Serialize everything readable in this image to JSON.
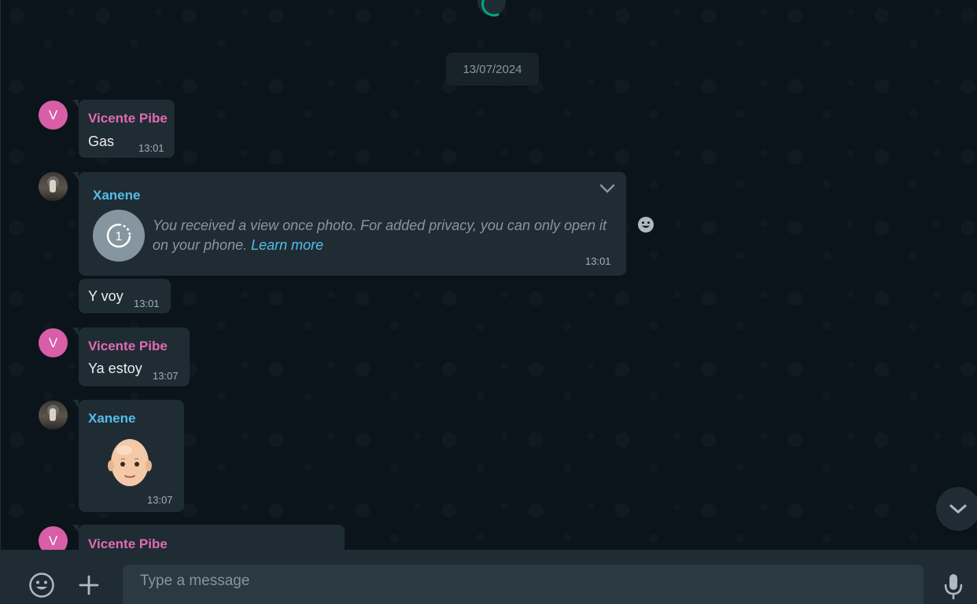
{
  "date_divider": "13/07/2024",
  "messages": [
    {
      "avatar_letter": "V",
      "sender": "Vicente Pibe",
      "text": "Gas",
      "time": "13:01"
    },
    {
      "sender": "Xanene",
      "view_once_text": "You received a view once photo. For added privacy, you can only open it on your phone.",
      "learn_more": "Learn more",
      "time": "13:01"
    },
    {
      "text": "Y voy",
      "time": "13:01"
    },
    {
      "avatar_letter": "V",
      "sender": "Vicente Pibe",
      "text": "Ya estoy",
      "time": "13:07"
    },
    {
      "sender": "Xanene",
      "time": "13:07",
      "sticker_icon": "bald-person-emoji"
    },
    {
      "avatar_letter": "V",
      "sender": "Vicente Pibe"
    }
  ],
  "composer": {
    "placeholder": "Type a message",
    "emoji_icon": "smiley-icon",
    "attach_icon": "plus-icon",
    "mic_icon": "microphone-icon"
  },
  "colors": {
    "background": "#0b141a",
    "bubble": "#202c33",
    "accent_green": "#00a884",
    "sender_pink": "#e26ab6",
    "sender_blue": "#53bdeb",
    "avatar_pink": "#d85ea8"
  }
}
